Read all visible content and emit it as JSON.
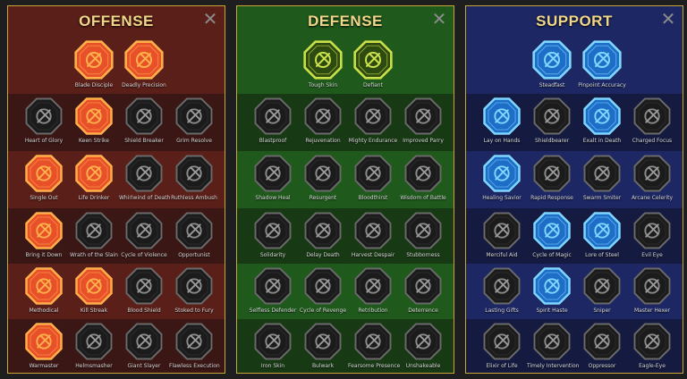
{
  "panels": [
    {
      "id": "offense",
      "title": "OFFENSE",
      "close_icon": "close-icon",
      "bg_a": "#3a1614",
      "bg_b": "#5a1f18",
      "rows": [
        [
          "Blade Disciple",
          "Deadly Precision"
        ],
        [
          "Heart of Glory",
          "Keen Strike",
          "Shield Breaker",
          "Grim Resolve"
        ],
        [
          "Single Out",
          "Life Drinker",
          "Whirlwind of Death",
          "Ruthless Ambush"
        ],
        [
          "Bring it Down",
          "Wrath of the Slain",
          "Cycle of Violence",
          "Opportunist"
        ],
        [
          "Methodical",
          "Kill Streak",
          "Blood Shield",
          "Stoked to Fury"
        ],
        [
          "Warmaster",
          "Helmsmasher",
          "Giant Slayer",
          "Flawless Execution"
        ]
      ],
      "active": [
        "Blade Disciple",
        "Deadly Precision",
        "Keen Strike",
        "Single Out",
        "Life Drinker",
        "Bring it Down",
        "Methodical",
        "Kill Streak",
        "Warmaster"
      ],
      "active_color": "#e8502a",
      "active_glow": "#ffb04a"
    },
    {
      "id": "defense",
      "title": "DEFENSE",
      "close_icon": "close-icon",
      "bg_a": "#173a14",
      "bg_b": "#1f5a1c",
      "rows": [
        [
          "Tough Skin",
          "Defiant"
        ],
        [
          "Blastproof",
          "Rejuvenation",
          "Mighty Endurance",
          "Improved Parry"
        ],
        [
          "Shadow Heal",
          "Resurgent",
          "Bloodthirst",
          "Wisdom of Battle"
        ],
        [
          "Solidarity",
          "Delay Death",
          "Harvest Despair",
          "Stubborness"
        ],
        [
          "Selfless Defender",
          "Cycle of Revenge",
          "Retribution",
          "Deterrence"
        ],
        [
          "Iron Skin",
          "Bulwark",
          "Fearsome Presence",
          "Unshakeable"
        ]
      ],
      "active": [
        "Tough Skin",
        "Defiant"
      ],
      "active_color": "#2d4a10",
      "active_glow": "#c9e04a"
    },
    {
      "id": "support",
      "title": "SUPPORT",
      "close_icon": "close-icon",
      "bg_a": "#141a40",
      "bg_b": "#1c2764",
      "rows": [
        [
          "Steadfast",
          "Pinpoint Accuracy"
        ],
        [
          "Lay on Hands",
          "Shieldbearer",
          "Exalt in Death",
          "Charged Focus"
        ],
        [
          "Healing Savior",
          "Rapid Response",
          "Swarm Smiter",
          "Arcane Celerity"
        ],
        [
          "Merciful Aid",
          "Cycle of Magic",
          "Lore of Steel",
          "Evil Eye"
        ],
        [
          "Lasting Gifts",
          "Spirit Haste",
          "Sniper",
          "Master Hexer"
        ],
        [
          "Elixir of Life",
          "Timely Intervention",
          "Oppressor",
          "Eagle-Eye"
        ]
      ],
      "active": [
        "Steadfast",
        "Pinpoint Accuracy",
        "Lay on Hands",
        "Exalt in Death",
        "Healing Savior",
        "Cycle of Magic",
        "Lore of Steel",
        "Spirit Haste"
      ],
      "active_color": "#1e6ec8",
      "active_glow": "#7fd6ff"
    }
  ],
  "inactive_color": "#1b1b1c",
  "inactive_border": "#6a6a6a"
}
